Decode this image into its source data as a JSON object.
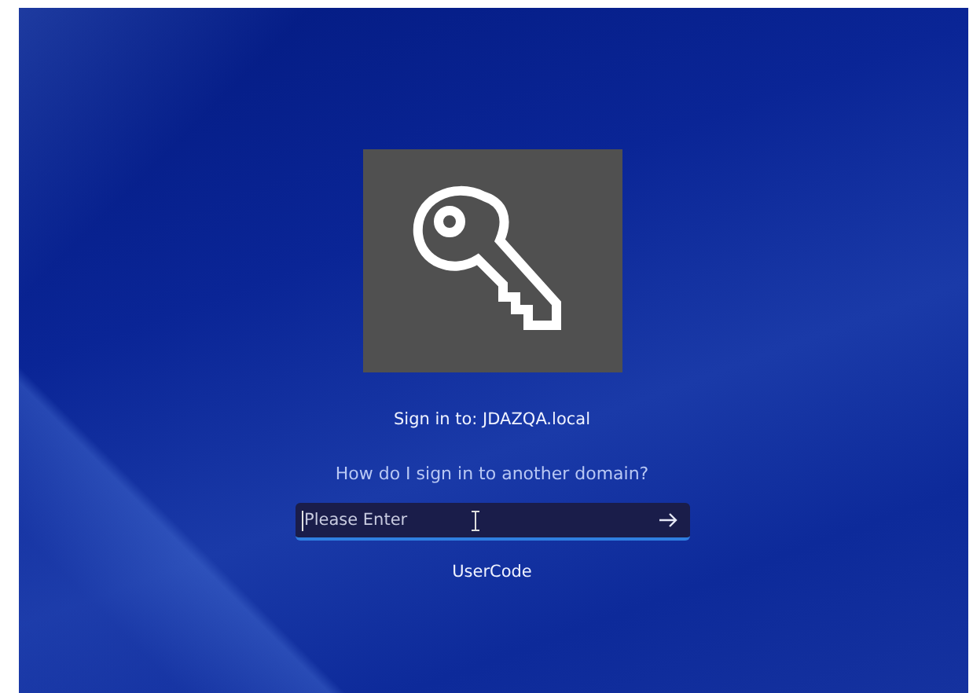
{
  "sign_in_to": "Sign in to: JDAZQA.local",
  "other_domain_link": "How do I sign in to another domain?",
  "user_code_field": {
    "placeholder": "Please Enter"
  },
  "field_label": "UserCode"
}
